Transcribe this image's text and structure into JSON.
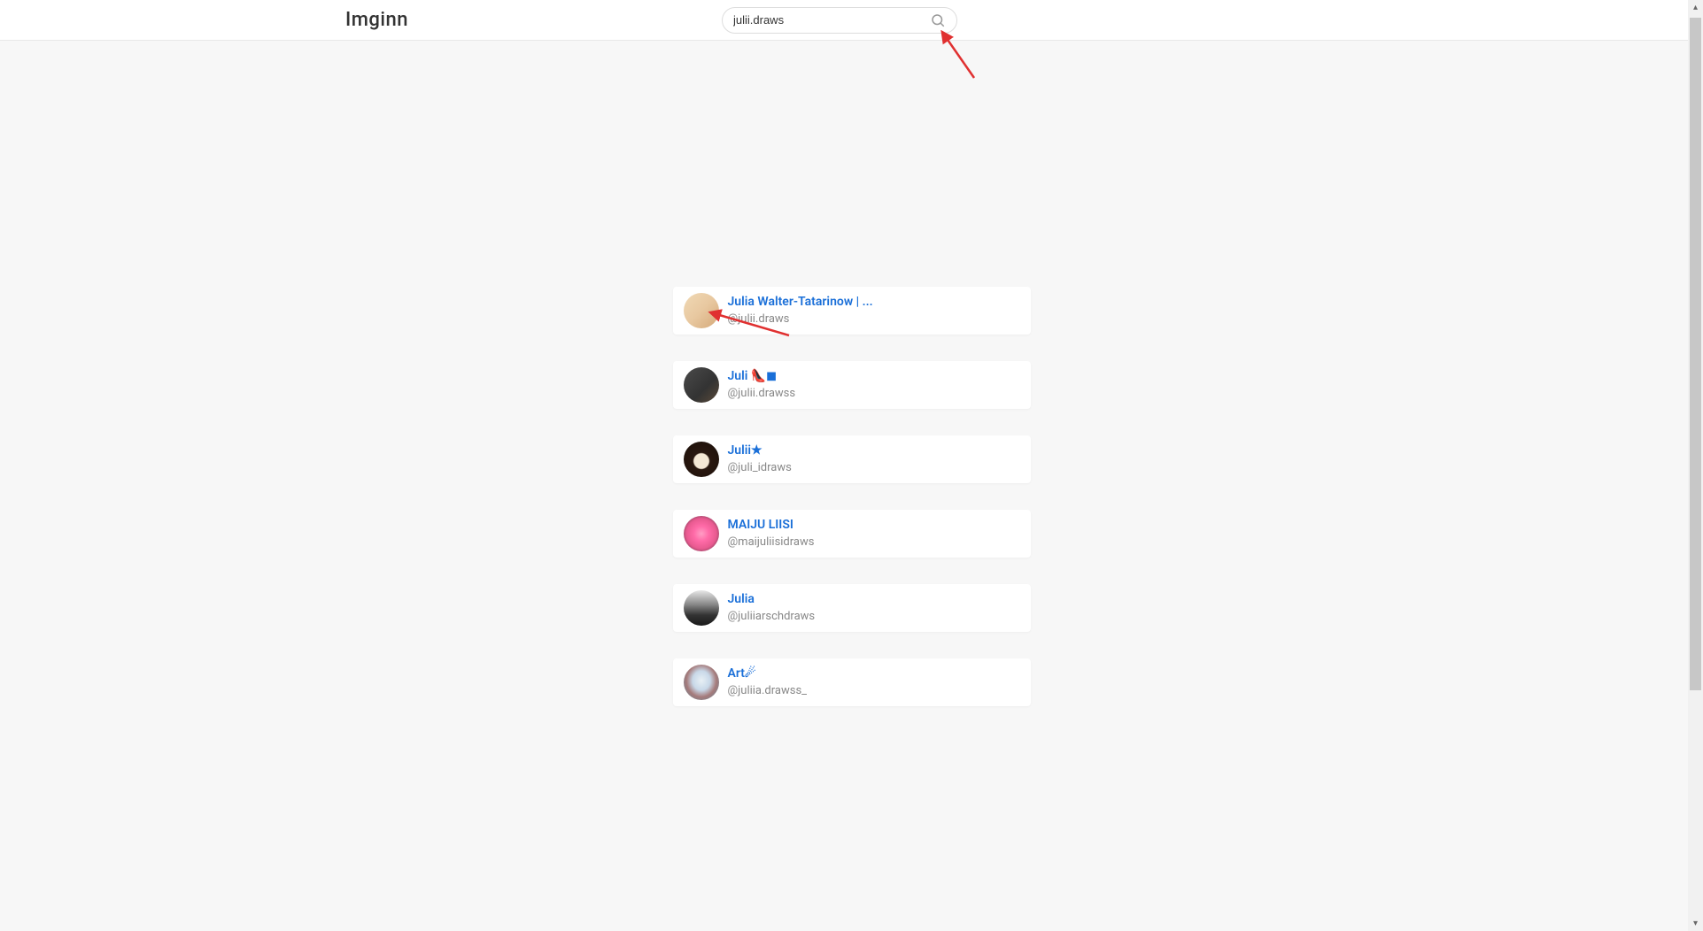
{
  "header": {
    "logo": "Imginn"
  },
  "search": {
    "value": "julii.draws",
    "placeholder": "Search"
  },
  "results": [
    {
      "display_name": "Julia Walter-Tatarinow | ...",
      "username": "@julii.draws",
      "avatar_bg": "linear-gradient(135deg, #f0d9b5 0%, #e8c8a0 50%, #d4a878 100%)"
    },
    {
      "display_name": "Juli 👠◼",
      "username": "@julii.drawss",
      "avatar_bg": "linear-gradient(135deg, #4a4a4a 0%, #333333 60%, #5a4a3a 100%)"
    },
    {
      "display_name": "Julii★",
      "username": "@juli_idraws",
      "avatar_bg": "radial-gradient(circle at 50% 55%, #f5e8d5 0%, #f5e8d5 28%, #2a1810 32%, #1a0f08 100%)"
    },
    {
      "display_name": "MAIJU LIISI",
      "username": "@maijuliisidraws",
      "avatar_bg": "radial-gradient(circle at 50% 50%, #ff9ec5 0%, #ff6ba8 30%, #e85a90 60%, #2a2a2a 100%)"
    },
    {
      "display_name": "Julia",
      "username": "@juliiarschdraws",
      "avatar_bg": "linear-gradient(180deg, #e8e8e8 0%, #888 40%, #333 70%, #1a1a1a 100%)"
    },
    {
      "display_name": "Art☄",
      "username": "@juliia.drawss_",
      "avatar_bg": "radial-gradient(ellipse at 50% 45%, #e8f0f5 0%, #c8d8e8 35%, #a57a7a 60%, #5a8aa0 100%)"
    }
  ]
}
